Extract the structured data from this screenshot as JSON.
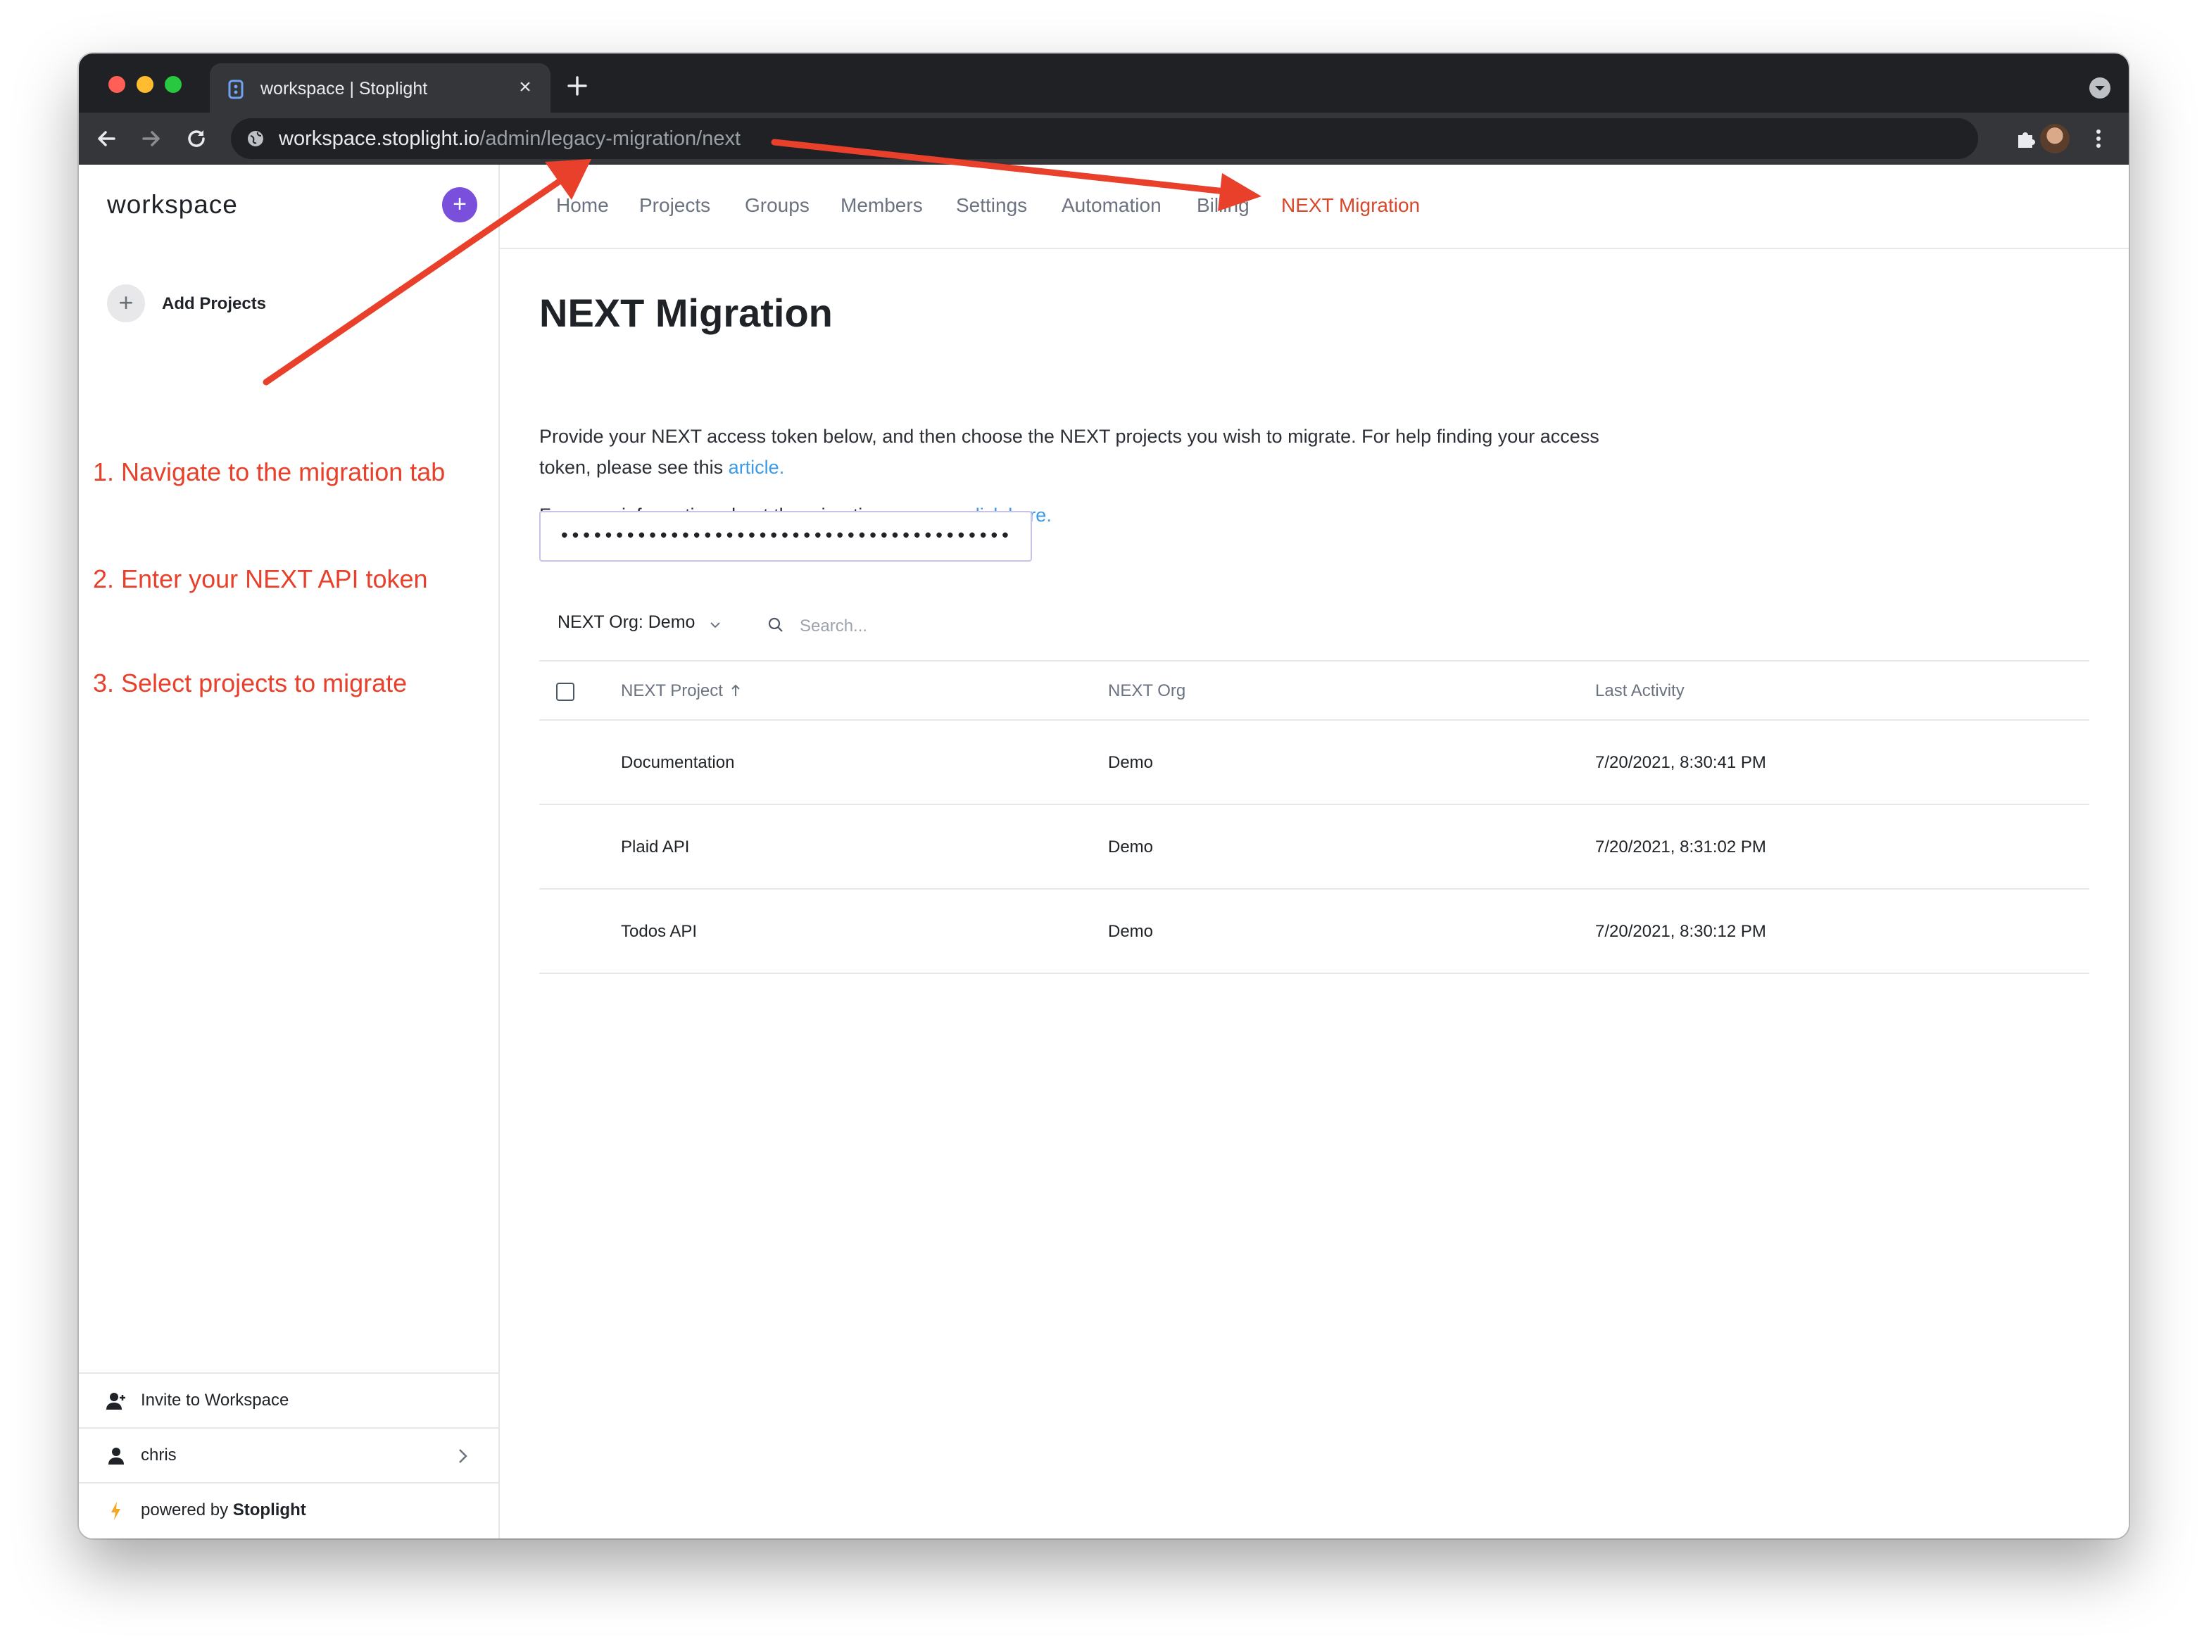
{
  "browser": {
    "tab_title": "workspace | Stoplight",
    "url_host": "workspace.stoplight.io",
    "url_path": "/admin/legacy-migration/next"
  },
  "sidebar": {
    "workspace_name": "workspace",
    "add_projects_label": "Add Projects",
    "invite_label": "Invite to Workspace",
    "user_name": "chris",
    "powered_by_prefix": "powered by ",
    "powered_by_brand": "Stoplight"
  },
  "annotations": {
    "step1": "1. Navigate to the migration tab",
    "step2": "2. Enter your NEXT API token",
    "step3": "3. Select projects to migrate",
    "color": "#e8402a"
  },
  "nav": {
    "tabs": [
      {
        "label": "Home"
      },
      {
        "label": "Projects"
      },
      {
        "label": "Groups"
      },
      {
        "label": "Members"
      },
      {
        "label": "Settings"
      },
      {
        "label": "Automation"
      },
      {
        "label": "Billing"
      },
      {
        "label": "NEXT Migration",
        "active": true
      }
    ],
    "active_color": "#d9482b"
  },
  "main": {
    "title": "NEXT Migration",
    "intro_text": "Provide your NEXT access token below, and then choose the NEXT projects you wish to migrate. For help finding your access token, please see this ",
    "intro_link": "article.",
    "info_text": "For more information about the migration process, ",
    "info_link": "click here.",
    "link_color": "#3b9ae8",
    "token_value": "•••••••••••••••••••••••••••••••••••••••••••••••••",
    "org_filter": "NEXT Org: Demo",
    "search_placeholder": "Search..."
  },
  "table": {
    "headers": [
      "NEXT Project",
      "NEXT Org",
      "Last Activity"
    ],
    "rows": [
      {
        "project": "Documentation",
        "org": "Demo",
        "last_activity": "7/20/2021, 8:30:41 PM"
      },
      {
        "project": "Plaid API",
        "org": "Demo",
        "last_activity": "7/20/2021, 8:31:02 PM"
      },
      {
        "project": "Todos API",
        "org": "Demo",
        "last_activity": "7/20/2021, 8:30:12 PM"
      }
    ]
  },
  "colors": {
    "brand_purple": "#7a4fdb",
    "chrome_dark": "#202124"
  }
}
